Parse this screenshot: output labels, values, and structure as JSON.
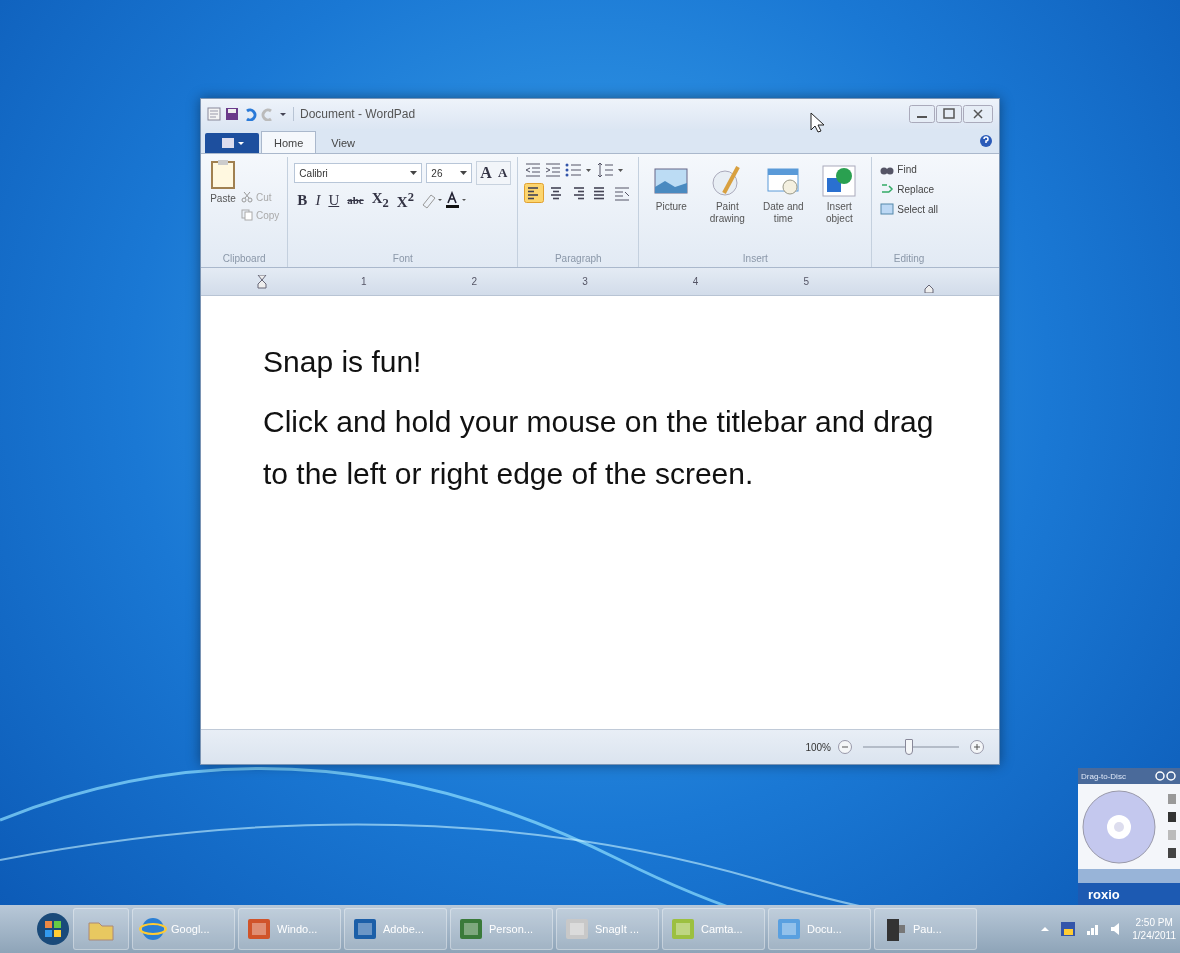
{
  "window": {
    "title": "Document - WordPad"
  },
  "tabs": [
    {
      "label": "Home",
      "selected": true
    },
    {
      "label": "View",
      "selected": false
    }
  ],
  "ribbon": {
    "clipboard": {
      "label": "Clipboard",
      "paste": "Paste",
      "cut": "Cut",
      "copy": "Copy"
    },
    "font": {
      "label": "Font",
      "family": "Calibri",
      "size": "26",
      "grow": "A",
      "shrink": "A",
      "formats": [
        {
          "kind": "bold",
          "text": "B"
        },
        {
          "kind": "italic",
          "text": "I"
        },
        {
          "kind": "underline",
          "text": "U"
        },
        {
          "kind": "strike",
          "text": "abc"
        },
        {
          "kind": "sub",
          "text": "X$_{2}$"
        },
        {
          "kind": "sup",
          "text": "X$^{2}$"
        }
      ]
    },
    "paragraph": {
      "label": "Paragraph",
      "alignments": [
        {
          "kind": "left",
          "selected": true
        },
        {
          "kind": "center",
          "selected": false
        },
        {
          "kind": "right",
          "selected": false
        },
        {
          "kind": "justify",
          "selected": false
        }
      ]
    },
    "insert": {
      "label": "Insert",
      "items": [
        {
          "kind": "picture",
          "label": "Picture"
        },
        {
          "kind": "paint",
          "label": "Paint drawing"
        },
        {
          "kind": "datetime",
          "label": "Date and time"
        },
        {
          "kind": "object",
          "label": "Insert object"
        }
      ]
    },
    "editing": {
      "label": "Editing",
      "items": [
        {
          "kind": "find",
          "label": "Find"
        },
        {
          "kind": "replace",
          "label": "Replace"
        },
        {
          "kind": "selectall",
          "label": "Select all"
        }
      ]
    }
  },
  "ruler": [
    "1",
    "2",
    "3",
    "4",
    "5"
  ],
  "document": {
    "paragraphs": [
      "Snap is fun!",
      "Click and hold your mouse on the titlebar and drag to the left or right edge of the screen."
    ]
  },
  "status_bar": {
    "zoom": "100%",
    "zoom_slider": {
      "level": 0.48
    }
  },
  "gadget": {
    "title": "Drag-to-Disc",
    "brand": "roxio"
  },
  "taskbar": {
    "items": [
      {
        "kind": "folder"
      },
      {
        "kind": "browser",
        "label": "Googl..."
      },
      {
        "kind": "slides",
        "label": "Windo..."
      },
      {
        "kind": "photo",
        "label": "Adobe..."
      },
      {
        "kind": "network",
        "label": "Person..."
      },
      {
        "kind": "capture",
        "label": "SnagIt ..."
      },
      {
        "kind": "recorder",
        "label": "Camta..."
      },
      {
        "kind": "document",
        "label": "Docu..."
      },
      {
        "kind": "camera",
        "label": "Pau..."
      }
    ],
    "time": "2:50 PM",
    "date": "1/24/2011"
  }
}
